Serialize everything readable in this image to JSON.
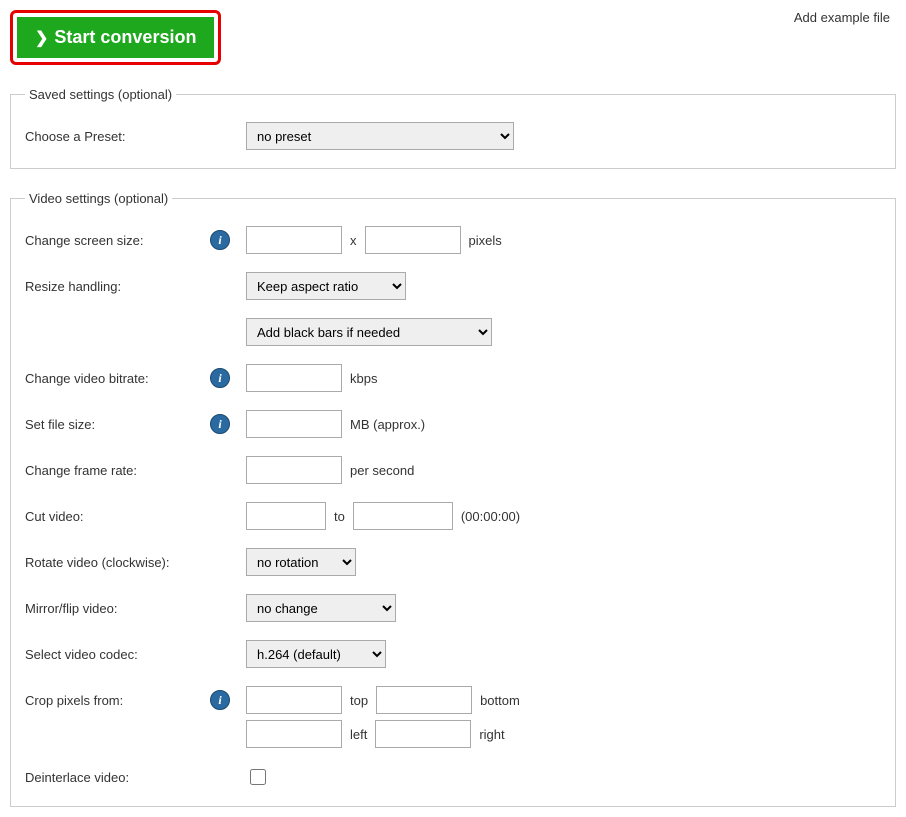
{
  "top": {
    "start_label": "Start conversion",
    "add_example": "Add example file"
  },
  "saved": {
    "legend": "Saved settings (optional)",
    "preset_label": "Choose a Preset:",
    "preset_value": "no preset"
  },
  "video": {
    "legend": "Video settings (optional)",
    "screen_label": "Change screen size:",
    "screen_x": "x",
    "screen_unit": "pixels",
    "resize_label": "Resize handling:",
    "resize1_value": "Keep aspect ratio",
    "resize2_value": "Add black bars if needed",
    "bitrate_label": "Change video bitrate:",
    "bitrate_unit": "kbps",
    "filesize_label": "Set file size:",
    "filesize_unit": "MB (approx.)",
    "framerate_label": "Change frame rate:",
    "framerate_unit": "per second",
    "cut_label": "Cut video:",
    "cut_to": "to",
    "cut_hint": "(00:00:00)",
    "rotate_label": "Rotate video (clockwise):",
    "rotate_value": "no rotation",
    "mirror_label": "Mirror/flip video:",
    "mirror_value": "no change",
    "codec_label": "Select video codec:",
    "codec_value": "h.264 (default)",
    "crop_label": "Crop pixels from:",
    "crop_top": "top",
    "crop_bottom": "bottom",
    "crop_left": "left",
    "crop_right": "right",
    "deinterlace_label": "Deinterlace video:"
  }
}
